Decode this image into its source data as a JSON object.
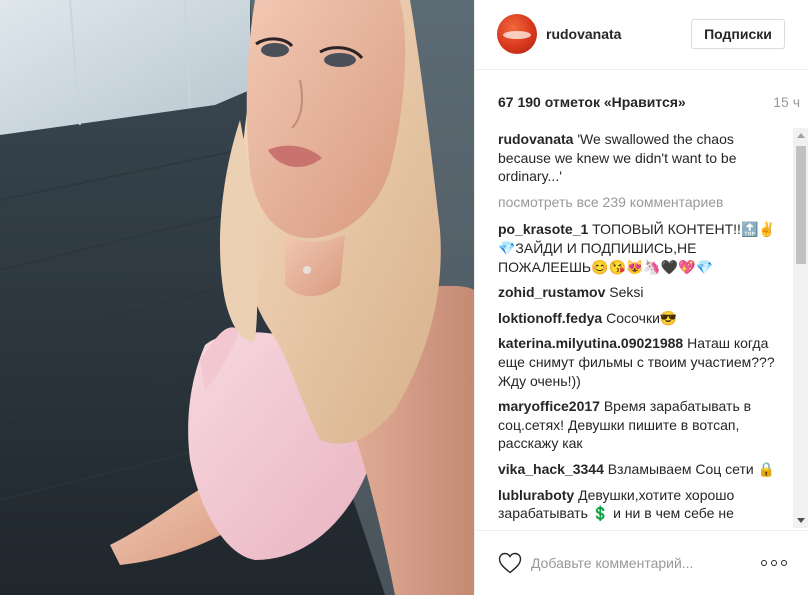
{
  "post": {
    "author": "rudovanata",
    "follow_button": "Подписки",
    "likes": "67 190 отметок «Нравится»",
    "time": "15 ч",
    "caption": {
      "user": "rudovanata",
      "text": "'We swallowed the chaos because we knew we didn't want to be ordinary...'"
    },
    "view_all": "посмотреть все 239 комментариев",
    "comments": [
      {
        "user": "po_krasote_1",
        "text": "ТОПОВЫЙ КОНТЕНТ!!🔝✌ 💎ЗАЙДИ И ПОДПИШИСЬ,НЕ ПОЖАЛЕЕШЬ😊😘😻🦄🖤💖💎"
      },
      {
        "user": "zohid_rustamov",
        "text": "Seksi"
      },
      {
        "user": "loktionoff.fedya",
        "text": "Сосочки😎"
      },
      {
        "user": "katerina.milyutina.09021988",
        "text": "Наташ когда еще снимут фильмы с твоим участием???Жду очень!))"
      },
      {
        "user": "maryoffice2017",
        "text": "Время зарабатывать в соц.сетях! Девушки пишите в вотсап, расскажу как"
      },
      {
        "user": "vika_hack_3344",
        "text": "Взламываем Соц сети 🔒"
      },
      {
        "user": "lubluraboty",
        "text": "Девушки,хотите хорошо зарабатывать 💲 и ни в чем себе не"
      }
    ],
    "comment_placeholder": "Добавьте комментарий..."
  },
  "icons": {
    "like": "heart-icon",
    "options": "more-options-icon",
    "avatar": "avatar"
  },
  "colors": {
    "username": "#262626",
    "secondary_text": "#999999",
    "border": "#dbdbdb"
  }
}
